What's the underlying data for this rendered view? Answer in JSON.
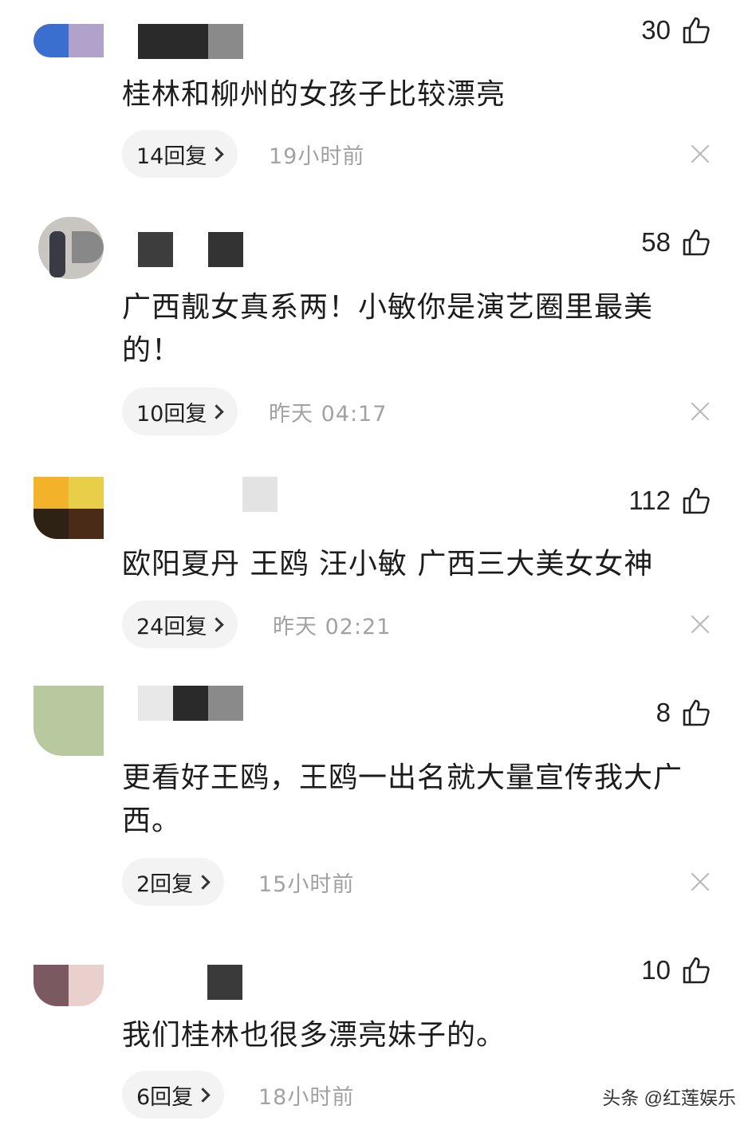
{
  "comments": [
    {
      "likes": "30",
      "text": "桂林和柳州的女孩子比较漂亮",
      "replies": "14回复",
      "time": "19小时前"
    },
    {
      "likes": "58",
      "text": "广西靓女真系两！小敏你是演艺圈里最美的！",
      "replies": "10回复",
      "time": "昨天  04:17"
    },
    {
      "likes": "112",
      "text": "欧阳夏丹 王鸥 汪小敏 广西三大美女女神",
      "replies": "24回复",
      "time": "昨天  02:21"
    },
    {
      "likes": "8",
      "text": "更看好王鸥，王鸥一出名就大量宣传我大广西。",
      "replies": "2回复",
      "time": "15小时前"
    },
    {
      "likes": "10",
      "text": "我们桂林也很多漂亮妹子的。",
      "replies": "6回复",
      "time": "18小时前"
    }
  ],
  "icons": {
    "like": "thumbs-up-icon",
    "close": "close-icon",
    "chevron": "chevron-right-icon"
  },
  "watermark": "头条 @红莲娱乐"
}
